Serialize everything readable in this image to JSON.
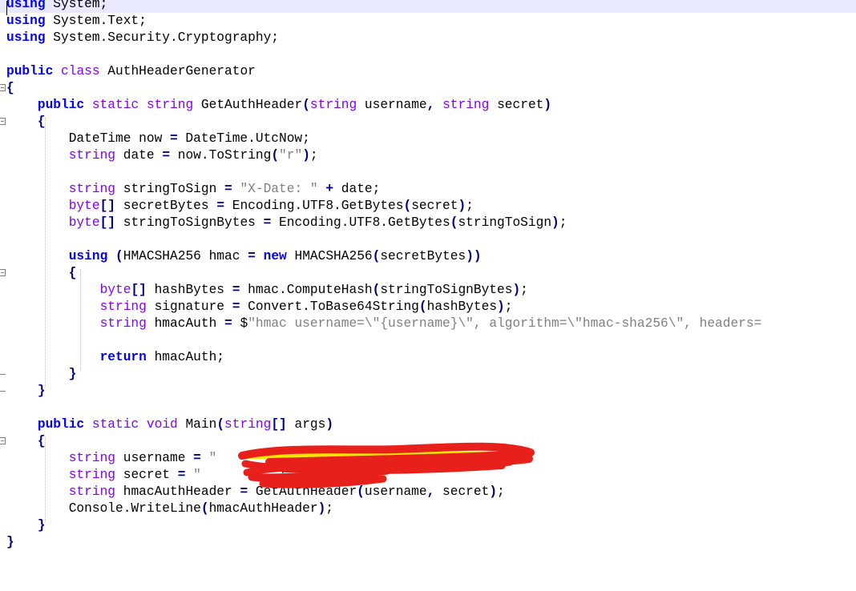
{
  "editor": {
    "lines": [
      [
        {
          "t": "using",
          "c": "kw"
        },
        {
          "t": " System;"
        }
      ],
      [
        {
          "t": "using",
          "c": "kw"
        },
        {
          "t": " System.Text;"
        }
      ],
      [
        {
          "t": "using",
          "c": "kw"
        },
        {
          "t": " System.Security.Cryptography;"
        }
      ],
      [],
      [
        {
          "t": "public",
          "c": "kw"
        },
        {
          "t": " "
        },
        {
          "t": "class",
          "c": "type"
        },
        {
          "t": " AuthHeaderGenerator"
        }
      ],
      [
        {
          "t": "{",
          "c": "op"
        }
      ],
      [
        {
          "t": "    "
        },
        {
          "t": "public",
          "c": "kw"
        },
        {
          "t": " "
        },
        {
          "t": "static",
          "c": "type"
        },
        {
          "t": " "
        },
        {
          "t": "string",
          "c": "type"
        },
        {
          "t": " GetAuthHeader"
        },
        {
          "t": "(",
          "c": "op"
        },
        {
          "t": "string",
          "c": "type"
        },
        {
          "t": " username"
        },
        {
          "t": ",",
          "c": "op"
        },
        {
          "t": " "
        },
        {
          "t": "string",
          "c": "type"
        },
        {
          "t": " secret"
        },
        {
          "t": ")",
          "c": "op"
        }
      ],
      [
        {
          "t": "    "
        },
        {
          "t": "{",
          "c": "op"
        }
      ],
      [
        {
          "t": "        DateTime now "
        },
        {
          "t": "=",
          "c": "op"
        },
        {
          "t": " DateTime.UtcNow;"
        }
      ],
      [
        {
          "t": "        "
        },
        {
          "t": "string",
          "c": "type"
        },
        {
          "t": " date "
        },
        {
          "t": "=",
          "c": "op"
        },
        {
          "t": " now.ToString"
        },
        {
          "t": "(",
          "c": "op"
        },
        {
          "t": "\"r\"",
          "c": "str"
        },
        {
          "t": ")",
          "c": "op"
        },
        {
          "t": ";"
        }
      ],
      [],
      [
        {
          "t": "        "
        },
        {
          "t": "string",
          "c": "type"
        },
        {
          "t": " stringToSign "
        },
        {
          "t": "=",
          "c": "op"
        },
        {
          "t": " "
        },
        {
          "t": "\"X-Date: \"",
          "c": "str"
        },
        {
          "t": " "
        },
        {
          "t": "+",
          "c": "op"
        },
        {
          "t": " date;"
        }
      ],
      [
        {
          "t": "        "
        },
        {
          "t": "byte",
          "c": "type"
        },
        {
          "t": "[]",
          "c": "op"
        },
        {
          "t": " secretBytes "
        },
        {
          "t": "=",
          "c": "op"
        },
        {
          "t": " Encoding.UTF8.GetBytes"
        },
        {
          "t": "(",
          "c": "op"
        },
        {
          "t": "secret"
        },
        {
          "t": ")",
          "c": "op"
        },
        {
          "t": ";"
        }
      ],
      [
        {
          "t": "        "
        },
        {
          "t": "byte",
          "c": "type"
        },
        {
          "t": "[]",
          "c": "op"
        },
        {
          "t": " stringToSignBytes "
        },
        {
          "t": "=",
          "c": "op"
        },
        {
          "t": " Encoding.UTF8.GetBytes"
        },
        {
          "t": "(",
          "c": "op"
        },
        {
          "t": "stringToSign"
        },
        {
          "t": ")",
          "c": "op"
        },
        {
          "t": ";"
        }
      ],
      [],
      [
        {
          "t": "        "
        },
        {
          "t": "using",
          "c": "kw"
        },
        {
          "t": " "
        },
        {
          "t": "(",
          "c": "op"
        },
        {
          "t": "HMACSHA256 hmac "
        },
        {
          "t": "=",
          "c": "op"
        },
        {
          "t": " "
        },
        {
          "t": "new",
          "c": "kw"
        },
        {
          "t": " HMACSHA256"
        },
        {
          "t": "(",
          "c": "op"
        },
        {
          "t": "secretBytes"
        },
        {
          "t": "))",
          "c": "op"
        }
      ],
      [
        {
          "t": "        "
        },
        {
          "t": "{",
          "c": "op"
        }
      ],
      [
        {
          "t": "            "
        },
        {
          "t": "byte",
          "c": "type"
        },
        {
          "t": "[]",
          "c": "op"
        },
        {
          "t": " hashBytes "
        },
        {
          "t": "=",
          "c": "op"
        },
        {
          "t": " hmac.ComputeHash"
        },
        {
          "t": "(",
          "c": "op"
        },
        {
          "t": "stringToSignBytes"
        },
        {
          "t": ")",
          "c": "op"
        },
        {
          "t": ";"
        }
      ],
      [
        {
          "t": "            "
        },
        {
          "t": "string",
          "c": "type"
        },
        {
          "t": " signature "
        },
        {
          "t": "=",
          "c": "op"
        },
        {
          "t": " Convert.ToBase64String"
        },
        {
          "t": "(",
          "c": "op"
        },
        {
          "t": "hashBytes"
        },
        {
          "t": ")",
          "c": "op"
        },
        {
          "t": ";"
        }
      ],
      [
        {
          "t": "            "
        },
        {
          "t": "string",
          "c": "type"
        },
        {
          "t": " hmacAuth "
        },
        {
          "t": "=",
          "c": "op"
        },
        {
          "t": " $"
        },
        {
          "t": "\"hmac username=\\\"{username}\\\", algorithm=\\\"hmac-sha256\\\", headers=",
          "c": "str"
        }
      ],
      [],
      [
        {
          "t": "            "
        },
        {
          "t": "return",
          "c": "kw"
        },
        {
          "t": " hmacAuth;"
        }
      ],
      [
        {
          "t": "        "
        },
        {
          "t": "}",
          "c": "op"
        }
      ],
      [
        {
          "t": "    "
        },
        {
          "t": "}",
          "c": "op"
        }
      ],
      [],
      [
        {
          "t": "    "
        },
        {
          "t": "public",
          "c": "kw"
        },
        {
          "t": " "
        },
        {
          "t": "static",
          "c": "type"
        },
        {
          "t": " "
        },
        {
          "t": "void",
          "c": "type"
        },
        {
          "t": " Main"
        },
        {
          "t": "(",
          "c": "op"
        },
        {
          "t": "string",
          "c": "type"
        },
        {
          "t": "[]",
          "c": "op"
        },
        {
          "t": " args"
        },
        {
          "t": ")",
          "c": "op"
        }
      ],
      [
        {
          "t": "    "
        },
        {
          "t": "{",
          "c": "op"
        }
      ],
      [
        {
          "t": "        "
        },
        {
          "t": "string",
          "c": "type"
        },
        {
          "t": " username "
        },
        {
          "t": "=",
          "c": "op"
        },
        {
          "t": " "
        },
        {
          "t": "\"",
          "c": "str"
        }
      ],
      [
        {
          "t": "        "
        },
        {
          "t": "string",
          "c": "type"
        },
        {
          "t": " secret "
        },
        {
          "t": "=",
          "c": "op"
        },
        {
          "t": " "
        },
        {
          "t": "\"",
          "c": "str"
        },
        {
          "t": "          "
        },
        {
          "t": ";"
        }
      ],
      [
        {
          "t": "        "
        },
        {
          "t": "string",
          "c": "type"
        },
        {
          "t": " hmacAuthHeader "
        },
        {
          "t": "=",
          "c": "op"
        },
        {
          "t": " GetAuthHeader"
        },
        {
          "t": "(",
          "c": "op"
        },
        {
          "t": "username"
        },
        {
          "t": ",",
          "c": "op"
        },
        {
          "t": " secret"
        },
        {
          "t": ")",
          "c": "op"
        },
        {
          "t": ";"
        }
      ],
      [
        {
          "t": "        Console.WriteLine"
        },
        {
          "t": "(",
          "c": "op"
        },
        {
          "t": "hmacAuthHeader"
        },
        {
          "t": ")",
          "c": "op"
        },
        {
          "t": ";"
        }
      ],
      [
        {
          "t": "    "
        },
        {
          "t": "}",
          "c": "op"
        }
      ],
      [
        {
          "t": "}",
          "c": "op"
        }
      ]
    ]
  },
  "colors": {
    "keyword": "#0000ff",
    "type": "#8000ff",
    "string": "#808080",
    "operator": "#000080",
    "current_line": "#e8e8ff",
    "redaction": "#e8201c"
  }
}
